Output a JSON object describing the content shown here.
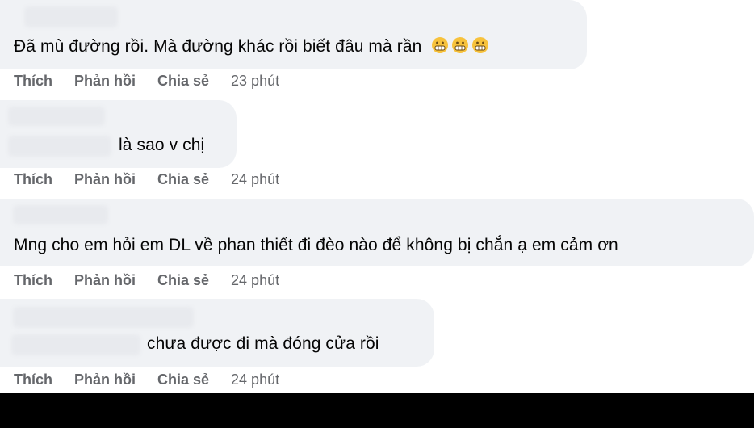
{
  "comments": [
    {
      "text": "Đã mù đường rồi. Mà đường khác rồi biết đâu mà rần",
      "emoji_icons": [
        "grimacing-face-icon",
        "grimacing-face-icon",
        "grimacing-face-icon"
      ],
      "actions": {
        "like": "Thích",
        "reply": "Phản hồi",
        "share": "Chia sẻ",
        "time": "23 phút"
      }
    },
    {
      "text": "là sao v chị",
      "actions": {
        "like": "Thích",
        "reply": "Phản hồi",
        "share": "Chia sẻ",
        "time": "24 phút"
      }
    },
    {
      "text": "Mng cho em hỏi em DL về phan thiết đi đèo nào để không bị chắn ạ em cảm ơn",
      "actions": {
        "like": "Thích",
        "reply": "Phản hồi",
        "share": "Chia sẻ",
        "time": "24 phút"
      }
    },
    {
      "text": "chưa được đi mà đóng cửa rồi",
      "actions": {
        "like": "Thích",
        "reply": "Phản hồi",
        "share": "Chia sẻ",
        "time": "24 phút"
      }
    }
  ],
  "colors": {
    "bubble": "#f0f2f5",
    "text": "#050505",
    "meta": "#65676b",
    "footer": "#000000"
  }
}
